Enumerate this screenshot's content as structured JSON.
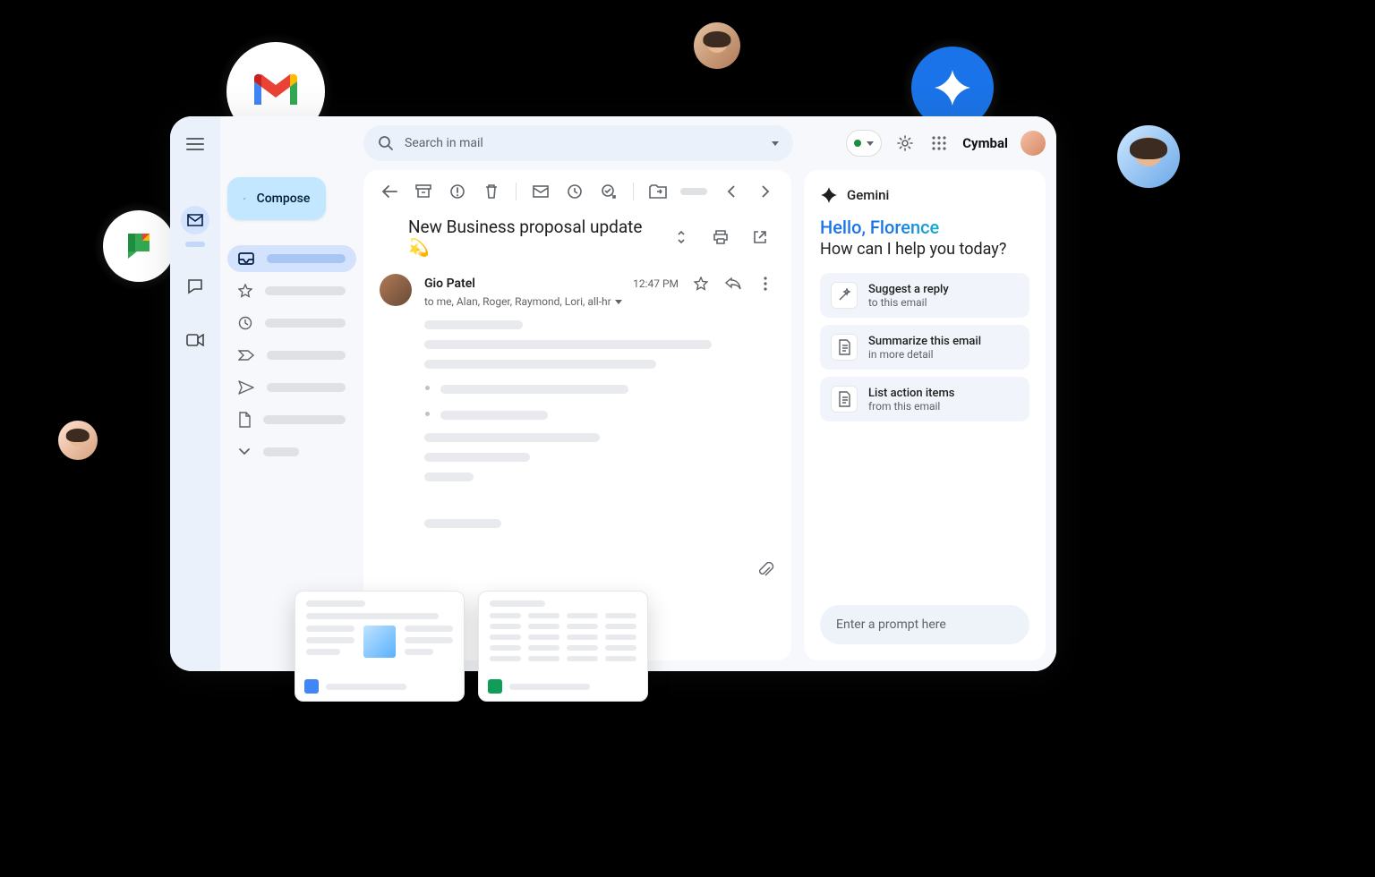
{
  "search": {
    "placeholder": "Search in mail"
  },
  "compose_label": "Compose",
  "brand": "Cymbal",
  "email": {
    "subject": "New Business proposal update💫",
    "sender": "Gio Patel",
    "recipients": "to me, Alan, Roger, Raymond, Lori, all-hr",
    "time": "12:47 PM"
  },
  "gemini": {
    "title": "Gemini",
    "hello": "Hello, Florence",
    "sub": "How can I help you today?",
    "prompt_placeholder": "Enter a prompt here",
    "suggestions": [
      {
        "title": "Suggest a reply",
        "sub": "to this email"
      },
      {
        "title": "Summarize this email",
        "sub": "in more detail"
      },
      {
        "title": "List action items",
        "sub": "from this email"
      }
    ]
  }
}
